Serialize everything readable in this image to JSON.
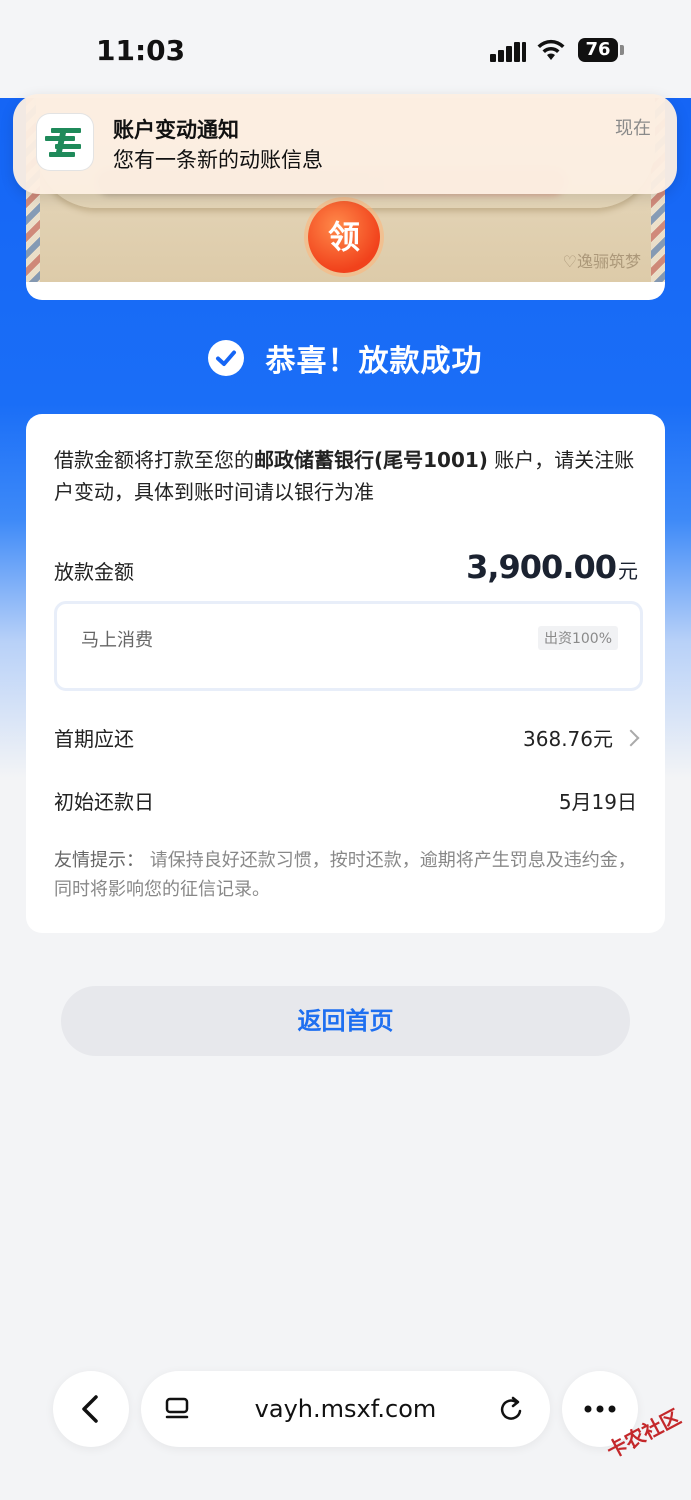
{
  "status_bar": {
    "time": "11:03",
    "battery": "76"
  },
  "notification": {
    "title": "账户变动通知",
    "body": "您有一条新的动账信息",
    "time": "现在",
    "app_icon": "postal-bank-icon"
  },
  "banner": {
    "claim_label": "领",
    "brand": "♡逸骊筑梦"
  },
  "success": {
    "text": "恭喜！放款成功"
  },
  "card": {
    "notice_prefix": "借款金额将打款至您的",
    "notice_bank": "邮政储蓄银行(尾号1001)",
    "notice_suffix": " 账户，请关注账户变动，具体到账时间请以银行为准",
    "amount_label": "放款金额",
    "amount_value": "3,900.00",
    "amount_unit": "元",
    "lender_name": "马上消费",
    "lender_share": "出资100%",
    "first_payment_label": "首期应还",
    "first_payment_value": "368.76元",
    "first_date_label": "初始还款日",
    "first_date_value": "5月19日",
    "tip_label": "友情提示：",
    "tip_text": " 请保持良好还款习惯，按时还款，逾期将产生罚息及违约金，同时将影响您的征信记录。"
  },
  "home_button": {
    "label": "返回首页"
  },
  "browser": {
    "url": "vayh.msxf.com"
  },
  "watermark": {
    "text": "卡农社区"
  },
  "colors": {
    "primary_blue": "#1565f5",
    "link_blue": "#1e6ff0"
  }
}
